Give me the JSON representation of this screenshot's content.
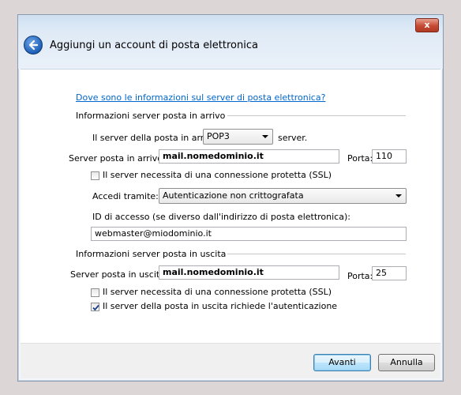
{
  "window": {
    "title": "Aggiungi un account di posta elettronica",
    "close_glyph": "x"
  },
  "help_link": "Dove sono le informazioni sul server di posta elettronica?",
  "incoming": {
    "section_title": "Informazioni server posta in arrivo",
    "server_type_prefix": "Il server della posta in arrivo è",
    "server_type_value": "POP3",
    "server_type_suffix": "server.",
    "server_label": "Server posta in arrivo:",
    "server_value": "mail.nomedominio.it",
    "port_label": "Porta:",
    "port_value": "110",
    "ssl_label": "Il server necessita di una connessione protetta (SSL)",
    "ssl_checked": false,
    "login_label": "Accedi tramite:",
    "login_value": "Autenticazione non crittografata",
    "id_label": "ID di accesso (se diverso dall'indirizzo di posta elettronica):",
    "id_value": "webmaster@miodominio.it"
  },
  "outgoing": {
    "section_title": "Informazioni server posta in uscita",
    "server_label": "Server posta in uscita:",
    "server_value": "mail.nomedominio.it",
    "port_label": "Porta:",
    "port_value": "25",
    "ssl_label": "Il server necessita di una connessione protetta (SSL)",
    "ssl_checked": false,
    "auth_label": "Il server della posta in uscita richiede l'autenticazione",
    "auth_checked": true
  },
  "buttons": {
    "next": "Avanti",
    "cancel": "Annulla"
  },
  "colors": {
    "link": "#0066cc",
    "close": "#c64a33",
    "back_button": "#1d5fb8"
  }
}
